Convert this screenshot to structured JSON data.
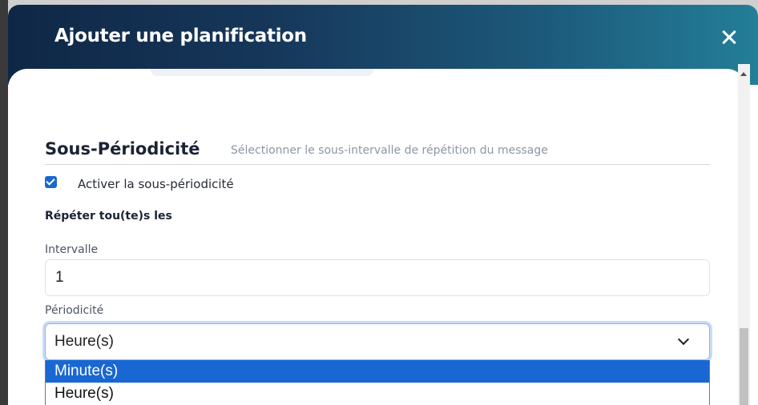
{
  "modal": {
    "title": "Ajouter une planification",
    "close_icon": "close-icon"
  },
  "section": {
    "title": "Sous-Périodicité",
    "subtitle": "Sélectionner le sous-intervalle de répétition du message"
  },
  "subperiodicity_toggle": {
    "label": "Activer la sous-périodicité",
    "checked": true
  },
  "repeat_label": "Répéter tou(te)s les",
  "interval": {
    "label": "Intervalle",
    "value": "1"
  },
  "periodicity": {
    "label": "Périodicité",
    "selected": "Heure(s)",
    "options": [
      "Minute(s)",
      "Heure(s)"
    ]
  },
  "colors": {
    "header_start": "#0f2746",
    "header_end": "#237e98",
    "accent": "#1967d2"
  }
}
